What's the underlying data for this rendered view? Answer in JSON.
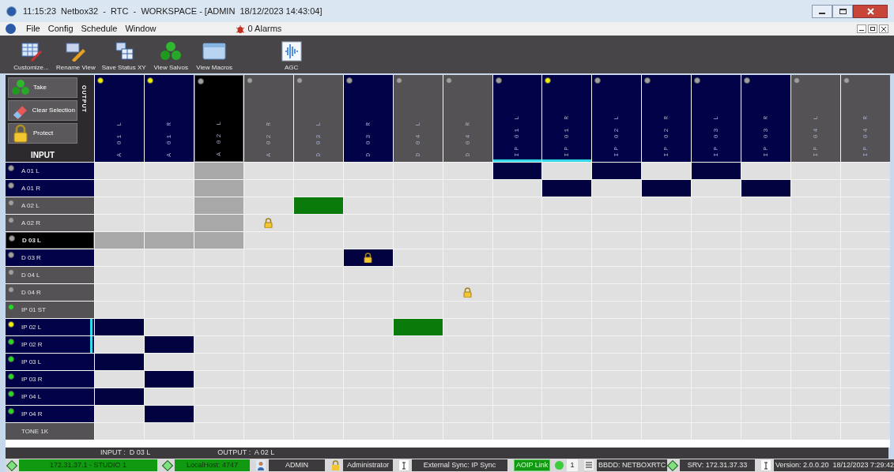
{
  "window": {
    "title": "11:15:23  Netbox32  -  RTC  -  WORKSPACE - [ADMIN  18/12/2023 14:43:04]"
  },
  "menu": [
    "File",
    "Config",
    "Schedule",
    "Window"
  ],
  "alarms": "0 Alarms",
  "toolbar": [
    "Customize...",
    "Rename View",
    "Save Status XY",
    "View Salvos",
    "View Macros",
    "AGC"
  ],
  "actions": [
    "Take",
    "Clear Selection",
    "Protect"
  ],
  "output_label": "OUTPUT",
  "input_label": "INPUT",
  "columns": [
    {
      "label": "A 01 L",
      "active": true,
      "selected": false,
      "color": "#f0f000",
      "linked": false
    },
    {
      "label": "A 01 R",
      "active": true,
      "selected": false,
      "color": "#f0f000",
      "linked": false
    },
    {
      "label": "A 02 L",
      "active": false,
      "selected": true,
      "color": "#a0a0a0",
      "linked": false
    },
    {
      "label": "A 02 R",
      "active": false,
      "selected": false,
      "color": "#a0a0a0",
      "linked": false
    },
    {
      "label": "D 03 L",
      "active": false,
      "selected": false,
      "color": "#a0a0a0",
      "linked": false
    },
    {
      "label": "D 03 R",
      "active": true,
      "selected": false,
      "color": "#a0a0a0",
      "linked": false
    },
    {
      "label": "D 04 L",
      "active": false,
      "selected": false,
      "color": "#a0a0a0",
      "linked": false
    },
    {
      "label": "D 04 R",
      "active": false,
      "selected": false,
      "color": "#a0a0a0",
      "linked": false
    },
    {
      "label": "IP 01 L",
      "active": true,
      "selected": false,
      "color": "#a0a0a0",
      "linked": true
    },
    {
      "label": "IP 01 R",
      "active": true,
      "selected": false,
      "color": "#f0f000",
      "linked": true
    },
    {
      "label": "IP 02 L",
      "active": true,
      "selected": false,
      "color": "#a0a0a0",
      "linked": false
    },
    {
      "label": "IP 02 R",
      "active": true,
      "selected": false,
      "color": "#a0a0a0",
      "linked": false
    },
    {
      "label": "IP 03 L",
      "active": true,
      "selected": false,
      "color": "#a0a0a0",
      "linked": false
    },
    {
      "label": "IP 03 R",
      "active": true,
      "selected": false,
      "color": "#a0a0a0",
      "linked": false
    },
    {
      "label": "IP 04 L",
      "active": false,
      "selected": false,
      "color": "#a0a0a0",
      "linked": false
    },
    {
      "label": "IP 04 R",
      "active": false,
      "selected": false,
      "color": "#a0a0a0",
      "linked": false
    }
  ],
  "rows": [
    {
      "label": "A 01 L",
      "active": true,
      "selected": false,
      "color": "#a0a0a0",
      "linked": false,
      "cells": [
        {
          "kind": "none"
        },
        {
          "kind": "none"
        },
        {
          "kind": "none"
        },
        {
          "kind": "none"
        },
        {
          "kind": "none"
        },
        {
          "kind": "none"
        },
        {
          "kind": "none"
        },
        {
          "kind": "none"
        },
        {
          "kind": "route"
        },
        {
          "kind": "none"
        },
        {
          "kind": "route"
        },
        {
          "kind": "none"
        },
        {
          "kind": "route"
        },
        {
          "kind": "none"
        },
        {
          "kind": "none"
        },
        {
          "kind": "none"
        }
      ]
    },
    {
      "label": "A 01 R",
      "active": true,
      "selected": false,
      "color": "#a0a0a0",
      "linked": false,
      "cells": [
        {
          "kind": "none"
        },
        {
          "kind": "none"
        },
        {
          "kind": "none"
        },
        {
          "kind": "none"
        },
        {
          "kind": "none"
        },
        {
          "kind": "none"
        },
        {
          "kind": "none"
        },
        {
          "kind": "none"
        },
        {
          "kind": "none"
        },
        {
          "kind": "route"
        },
        {
          "kind": "none"
        },
        {
          "kind": "route"
        },
        {
          "kind": "none"
        },
        {
          "kind": "route"
        },
        {
          "kind": "none"
        },
        {
          "kind": "none"
        }
      ]
    },
    {
      "label": "A 02 L",
      "active": false,
      "selected": false,
      "color": "#a0a0a0",
      "linked": false,
      "cells": [
        {
          "kind": "none"
        },
        {
          "kind": "none"
        },
        {
          "kind": "none"
        },
        {
          "kind": "none"
        },
        {
          "kind": "green"
        },
        {
          "kind": "none"
        },
        {
          "kind": "none"
        },
        {
          "kind": "none"
        },
        {
          "kind": "none"
        },
        {
          "kind": "none"
        },
        {
          "kind": "none"
        },
        {
          "kind": "none"
        },
        {
          "kind": "none"
        },
        {
          "kind": "none"
        },
        {
          "kind": "none"
        },
        {
          "kind": "none"
        }
      ]
    },
    {
      "label": "A 02 R",
      "active": false,
      "selected": false,
      "color": "#a0a0a0",
      "linked": false,
      "cells": [
        {
          "kind": "none"
        },
        {
          "kind": "none"
        },
        {
          "kind": "none"
        },
        {
          "kind": "locked"
        },
        {
          "kind": "none"
        },
        {
          "kind": "none"
        },
        {
          "kind": "none"
        },
        {
          "kind": "none"
        },
        {
          "kind": "none"
        },
        {
          "kind": "none"
        },
        {
          "kind": "none"
        },
        {
          "kind": "none"
        },
        {
          "kind": "none"
        },
        {
          "kind": "none"
        },
        {
          "kind": "none"
        },
        {
          "kind": "none"
        }
      ]
    },
    {
      "label": "D 03 L",
      "active": false,
      "selected": true,
      "color": "#a0a0a0",
      "linked": false,
      "cells": [
        {
          "kind": "none"
        },
        {
          "kind": "none"
        },
        {
          "kind": "none"
        },
        {
          "kind": "none"
        },
        {
          "kind": "none"
        },
        {
          "kind": "none"
        },
        {
          "kind": "none"
        },
        {
          "kind": "none"
        },
        {
          "kind": "none"
        },
        {
          "kind": "none"
        },
        {
          "kind": "none"
        },
        {
          "kind": "none"
        },
        {
          "kind": "none"
        },
        {
          "kind": "none"
        },
        {
          "kind": "none"
        },
        {
          "kind": "none"
        }
      ]
    },
    {
      "label": "D 03 R",
      "active": true,
      "selected": false,
      "color": "#a0a0a0",
      "linked": false,
      "cells": [
        {
          "kind": "none"
        },
        {
          "kind": "none"
        },
        {
          "kind": "none"
        },
        {
          "kind": "none"
        },
        {
          "kind": "none"
        },
        {
          "kind": "route-locked"
        },
        {
          "kind": "none"
        },
        {
          "kind": "none"
        },
        {
          "kind": "none"
        },
        {
          "kind": "none"
        },
        {
          "kind": "none"
        },
        {
          "kind": "none"
        },
        {
          "kind": "none"
        },
        {
          "kind": "none"
        },
        {
          "kind": "none"
        },
        {
          "kind": "none"
        }
      ]
    },
    {
      "label": "D 04 L",
      "active": false,
      "selected": false,
      "color": "#a0a0a0",
      "linked": false,
      "cells": [
        {
          "kind": "none"
        },
        {
          "kind": "none"
        },
        {
          "kind": "none"
        },
        {
          "kind": "none"
        },
        {
          "kind": "none"
        },
        {
          "kind": "none"
        },
        {
          "kind": "none"
        },
        {
          "kind": "none"
        },
        {
          "kind": "none"
        },
        {
          "kind": "none"
        },
        {
          "kind": "none"
        },
        {
          "kind": "none"
        },
        {
          "kind": "none"
        },
        {
          "kind": "none"
        },
        {
          "kind": "none"
        },
        {
          "kind": "none"
        }
      ]
    },
    {
      "label": "D 04 R",
      "active": false,
      "selected": false,
      "color": "#a0a0a0",
      "linked": false,
      "cells": [
        {
          "kind": "none"
        },
        {
          "kind": "none"
        },
        {
          "kind": "none"
        },
        {
          "kind": "none"
        },
        {
          "kind": "none"
        },
        {
          "kind": "none"
        },
        {
          "kind": "none"
        },
        {
          "kind": "locked"
        },
        {
          "kind": "none"
        },
        {
          "kind": "none"
        },
        {
          "kind": "none"
        },
        {
          "kind": "none"
        },
        {
          "kind": "none"
        },
        {
          "kind": "none"
        },
        {
          "kind": "none"
        },
        {
          "kind": "none"
        }
      ]
    },
    {
      "label": "IP 01 ST",
      "active": false,
      "selected": false,
      "color": "#22dd22",
      "linked": false,
      "cells": [
        {
          "kind": "none"
        },
        {
          "kind": "none"
        },
        {
          "kind": "none"
        },
        {
          "kind": "none"
        },
        {
          "kind": "none"
        },
        {
          "kind": "none"
        },
        {
          "kind": "none"
        },
        {
          "kind": "none"
        },
        {
          "kind": "none"
        },
        {
          "kind": "none"
        },
        {
          "kind": "none"
        },
        {
          "kind": "none"
        },
        {
          "kind": "none"
        },
        {
          "kind": "none"
        },
        {
          "kind": "none"
        },
        {
          "kind": "none"
        }
      ]
    },
    {
      "label": "IP 02 L",
      "active": true,
      "selected": false,
      "color": "#f0f000",
      "linked": true,
      "cells": [
        {
          "kind": "route"
        },
        {
          "kind": "none"
        },
        {
          "kind": "none"
        },
        {
          "kind": "none"
        },
        {
          "kind": "none"
        },
        {
          "kind": "none"
        },
        {
          "kind": "green"
        },
        {
          "kind": "none"
        },
        {
          "kind": "none"
        },
        {
          "kind": "none"
        },
        {
          "kind": "none"
        },
        {
          "kind": "none"
        },
        {
          "kind": "none"
        },
        {
          "kind": "none"
        },
        {
          "kind": "none"
        },
        {
          "kind": "none"
        }
      ]
    },
    {
      "label": "IP 02 R",
      "active": true,
      "selected": false,
      "color": "#22dd22",
      "linked": true,
      "cells": [
        {
          "kind": "none"
        },
        {
          "kind": "route"
        },
        {
          "kind": "none"
        },
        {
          "kind": "none"
        },
        {
          "kind": "none"
        },
        {
          "kind": "none"
        },
        {
          "kind": "none"
        },
        {
          "kind": "none"
        },
        {
          "kind": "none"
        },
        {
          "kind": "none"
        },
        {
          "kind": "none"
        },
        {
          "kind": "none"
        },
        {
          "kind": "none"
        },
        {
          "kind": "none"
        },
        {
          "kind": "none"
        },
        {
          "kind": "none"
        }
      ]
    },
    {
      "label": "IP 03 L",
      "active": true,
      "selected": false,
      "color": "#22dd22",
      "linked": false,
      "cells": [
        {
          "kind": "route"
        },
        {
          "kind": "none"
        },
        {
          "kind": "none"
        },
        {
          "kind": "none"
        },
        {
          "kind": "none"
        },
        {
          "kind": "none"
        },
        {
          "kind": "none"
        },
        {
          "kind": "none"
        },
        {
          "kind": "none"
        },
        {
          "kind": "none"
        },
        {
          "kind": "none"
        },
        {
          "kind": "none"
        },
        {
          "kind": "none"
        },
        {
          "kind": "none"
        },
        {
          "kind": "none"
        },
        {
          "kind": "none"
        }
      ]
    },
    {
      "label": "IP 03 R",
      "active": true,
      "selected": false,
      "color": "#22dd22",
      "linked": false,
      "cells": [
        {
          "kind": "none"
        },
        {
          "kind": "route"
        },
        {
          "kind": "none"
        },
        {
          "kind": "none"
        },
        {
          "kind": "none"
        },
        {
          "kind": "none"
        },
        {
          "kind": "none"
        },
        {
          "kind": "none"
        },
        {
          "kind": "none"
        },
        {
          "kind": "none"
        },
        {
          "kind": "none"
        },
        {
          "kind": "none"
        },
        {
          "kind": "none"
        },
        {
          "kind": "none"
        },
        {
          "kind": "none"
        },
        {
          "kind": "none"
        }
      ]
    },
    {
      "label": "IP 04 L",
      "active": true,
      "selected": false,
      "color": "#22dd22",
      "linked": false,
      "cells": [
        {
          "kind": "route"
        },
        {
          "kind": "none"
        },
        {
          "kind": "none"
        },
        {
          "kind": "none"
        },
        {
          "kind": "none"
        },
        {
          "kind": "none"
        },
        {
          "kind": "none"
        },
        {
          "kind": "none"
        },
        {
          "kind": "none"
        },
        {
          "kind": "none"
        },
        {
          "kind": "none"
        },
        {
          "kind": "none"
        },
        {
          "kind": "none"
        },
        {
          "kind": "none"
        },
        {
          "kind": "none"
        },
        {
          "kind": "none"
        }
      ]
    },
    {
      "label": "IP 04 R",
      "active": true,
      "selected": false,
      "color": "#22dd22",
      "linked": false,
      "cells": [
        {
          "kind": "none"
        },
        {
          "kind": "route"
        },
        {
          "kind": "none"
        },
        {
          "kind": "none"
        },
        {
          "kind": "none"
        },
        {
          "kind": "none"
        },
        {
          "kind": "none"
        },
        {
          "kind": "none"
        },
        {
          "kind": "none"
        },
        {
          "kind": "none"
        },
        {
          "kind": "none"
        },
        {
          "kind": "none"
        },
        {
          "kind": "none"
        },
        {
          "kind": "none"
        },
        {
          "kind": "none"
        },
        {
          "kind": "none"
        }
      ]
    },
    {
      "label": "TONE 1K",
      "active": false,
      "selected": false,
      "linked": false,
      "cells": [
        {
          "kind": "none"
        },
        {
          "kind": "none"
        },
        {
          "kind": "none"
        },
        {
          "kind": "none"
        },
        {
          "kind": "none"
        },
        {
          "kind": "none"
        },
        {
          "kind": "none"
        },
        {
          "kind": "none"
        },
        {
          "kind": "none"
        },
        {
          "kind": "none"
        },
        {
          "kind": "none"
        },
        {
          "kind": "none"
        },
        {
          "kind": "none"
        },
        {
          "kind": "none"
        },
        {
          "kind": "none"
        },
        {
          "kind": "none"
        }
      ]
    }
  ],
  "selection": {
    "input": "INPUT :  D 03 L",
    "output": "OUTPUT :  A 02 L"
  },
  "status_bar": [
    {
      "text": "172.31.37.1 - STUDIO 1",
      "kind": "ok"
    },
    {
      "text": "LocalHost: 4747",
      "kind": "ok"
    },
    {
      "text": "ADMIN",
      "kind": "plain"
    },
    {
      "text": "Administrator",
      "kind": "plain"
    },
    {
      "text": "External Sync: IP Sync",
      "kind": "plain"
    },
    {
      "text": "AOIP Link",
      "kind": "link"
    },
    {
      "text": "1",
      "kind": "light"
    },
    {
      "text": "BBDD: NETBOXRTC",
      "kind": "plain"
    },
    {
      "text": "SRV: 172.31.37.33",
      "kind": "plain"
    },
    {
      "text": "Version: 2.0.0.20  18/12/2023 7:29:42",
      "kind": "plain"
    }
  ]
}
